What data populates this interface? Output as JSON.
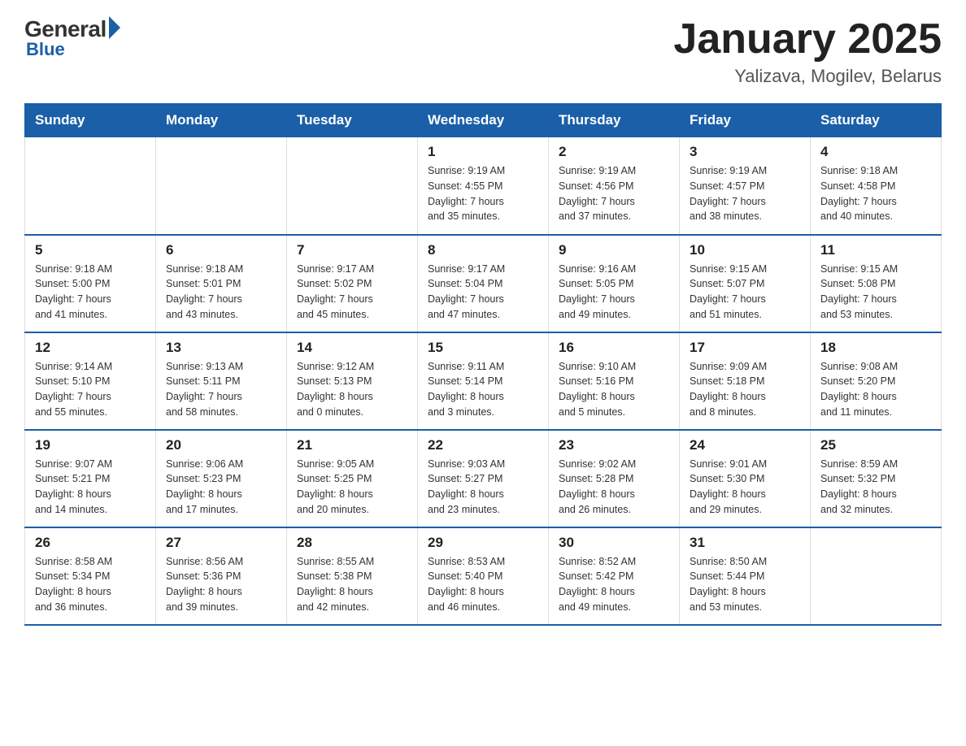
{
  "logo": {
    "general": "General",
    "blue": "Blue"
  },
  "header": {
    "month": "January 2025",
    "location": "Yalizava, Mogilev, Belarus"
  },
  "days_of_week": [
    "Sunday",
    "Monday",
    "Tuesday",
    "Wednesday",
    "Thursday",
    "Friday",
    "Saturday"
  ],
  "weeks": [
    [
      {
        "day": "",
        "info": ""
      },
      {
        "day": "",
        "info": ""
      },
      {
        "day": "",
        "info": ""
      },
      {
        "day": "1",
        "info": "Sunrise: 9:19 AM\nSunset: 4:55 PM\nDaylight: 7 hours\nand 35 minutes."
      },
      {
        "day": "2",
        "info": "Sunrise: 9:19 AM\nSunset: 4:56 PM\nDaylight: 7 hours\nand 37 minutes."
      },
      {
        "day": "3",
        "info": "Sunrise: 9:19 AM\nSunset: 4:57 PM\nDaylight: 7 hours\nand 38 minutes."
      },
      {
        "day": "4",
        "info": "Sunrise: 9:18 AM\nSunset: 4:58 PM\nDaylight: 7 hours\nand 40 minutes."
      }
    ],
    [
      {
        "day": "5",
        "info": "Sunrise: 9:18 AM\nSunset: 5:00 PM\nDaylight: 7 hours\nand 41 minutes."
      },
      {
        "day": "6",
        "info": "Sunrise: 9:18 AM\nSunset: 5:01 PM\nDaylight: 7 hours\nand 43 minutes."
      },
      {
        "day": "7",
        "info": "Sunrise: 9:17 AM\nSunset: 5:02 PM\nDaylight: 7 hours\nand 45 minutes."
      },
      {
        "day": "8",
        "info": "Sunrise: 9:17 AM\nSunset: 5:04 PM\nDaylight: 7 hours\nand 47 minutes."
      },
      {
        "day": "9",
        "info": "Sunrise: 9:16 AM\nSunset: 5:05 PM\nDaylight: 7 hours\nand 49 minutes."
      },
      {
        "day": "10",
        "info": "Sunrise: 9:15 AM\nSunset: 5:07 PM\nDaylight: 7 hours\nand 51 minutes."
      },
      {
        "day": "11",
        "info": "Sunrise: 9:15 AM\nSunset: 5:08 PM\nDaylight: 7 hours\nand 53 minutes."
      }
    ],
    [
      {
        "day": "12",
        "info": "Sunrise: 9:14 AM\nSunset: 5:10 PM\nDaylight: 7 hours\nand 55 minutes."
      },
      {
        "day": "13",
        "info": "Sunrise: 9:13 AM\nSunset: 5:11 PM\nDaylight: 7 hours\nand 58 minutes."
      },
      {
        "day": "14",
        "info": "Sunrise: 9:12 AM\nSunset: 5:13 PM\nDaylight: 8 hours\nand 0 minutes."
      },
      {
        "day": "15",
        "info": "Sunrise: 9:11 AM\nSunset: 5:14 PM\nDaylight: 8 hours\nand 3 minutes."
      },
      {
        "day": "16",
        "info": "Sunrise: 9:10 AM\nSunset: 5:16 PM\nDaylight: 8 hours\nand 5 minutes."
      },
      {
        "day": "17",
        "info": "Sunrise: 9:09 AM\nSunset: 5:18 PM\nDaylight: 8 hours\nand 8 minutes."
      },
      {
        "day": "18",
        "info": "Sunrise: 9:08 AM\nSunset: 5:20 PM\nDaylight: 8 hours\nand 11 minutes."
      }
    ],
    [
      {
        "day": "19",
        "info": "Sunrise: 9:07 AM\nSunset: 5:21 PM\nDaylight: 8 hours\nand 14 minutes."
      },
      {
        "day": "20",
        "info": "Sunrise: 9:06 AM\nSunset: 5:23 PM\nDaylight: 8 hours\nand 17 minutes."
      },
      {
        "day": "21",
        "info": "Sunrise: 9:05 AM\nSunset: 5:25 PM\nDaylight: 8 hours\nand 20 minutes."
      },
      {
        "day": "22",
        "info": "Sunrise: 9:03 AM\nSunset: 5:27 PM\nDaylight: 8 hours\nand 23 minutes."
      },
      {
        "day": "23",
        "info": "Sunrise: 9:02 AM\nSunset: 5:28 PM\nDaylight: 8 hours\nand 26 minutes."
      },
      {
        "day": "24",
        "info": "Sunrise: 9:01 AM\nSunset: 5:30 PM\nDaylight: 8 hours\nand 29 minutes."
      },
      {
        "day": "25",
        "info": "Sunrise: 8:59 AM\nSunset: 5:32 PM\nDaylight: 8 hours\nand 32 minutes."
      }
    ],
    [
      {
        "day": "26",
        "info": "Sunrise: 8:58 AM\nSunset: 5:34 PM\nDaylight: 8 hours\nand 36 minutes."
      },
      {
        "day": "27",
        "info": "Sunrise: 8:56 AM\nSunset: 5:36 PM\nDaylight: 8 hours\nand 39 minutes."
      },
      {
        "day": "28",
        "info": "Sunrise: 8:55 AM\nSunset: 5:38 PM\nDaylight: 8 hours\nand 42 minutes."
      },
      {
        "day": "29",
        "info": "Sunrise: 8:53 AM\nSunset: 5:40 PM\nDaylight: 8 hours\nand 46 minutes."
      },
      {
        "day": "30",
        "info": "Sunrise: 8:52 AM\nSunset: 5:42 PM\nDaylight: 8 hours\nand 49 minutes."
      },
      {
        "day": "31",
        "info": "Sunrise: 8:50 AM\nSunset: 5:44 PM\nDaylight: 8 hours\nand 53 minutes."
      },
      {
        "day": "",
        "info": ""
      }
    ]
  ]
}
